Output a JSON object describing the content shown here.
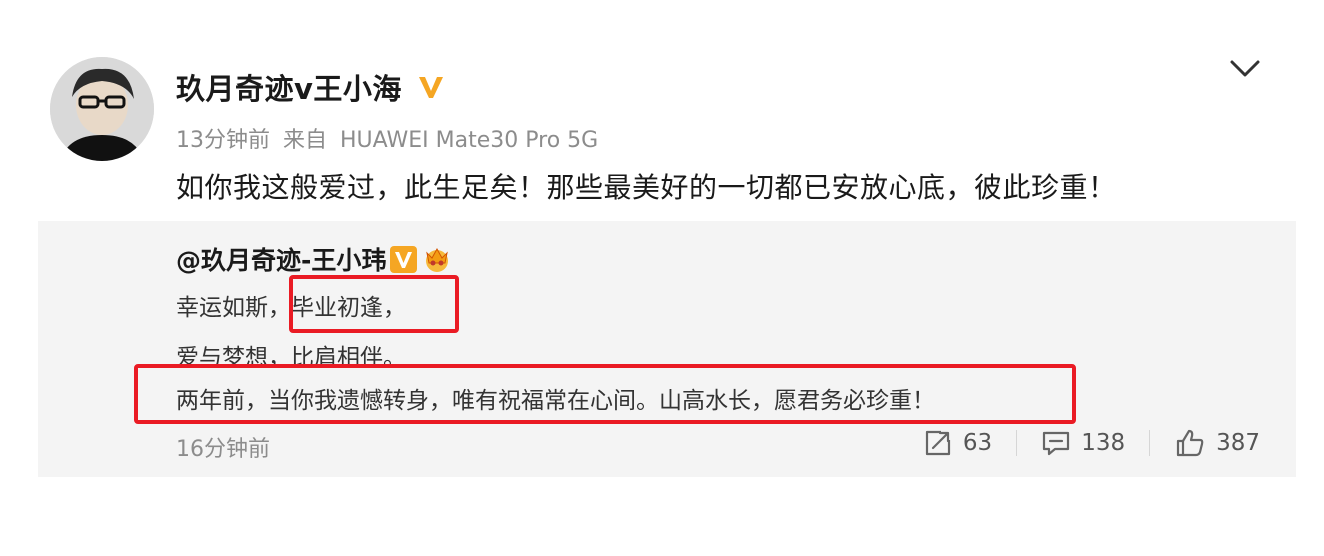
{
  "post": {
    "author": "玖月奇迹v王小海",
    "meta_time": "13分钟前",
    "meta_from": "来自",
    "meta_device": "HUAWEI Mate30 Pro 5G",
    "text": "如你我这般爱过，此生足矣！那些最美好的一切都已安放心底，彼此珍重！"
  },
  "repost": {
    "author": "@玖月奇迹-王小玮",
    "line1_prefix": "幸运如斯，",
    "line1_highlight": "毕业初逢，",
    "line2": "爱与梦想，比肩相伴。",
    "line3": "两年前，当你我遗憾转身，唯有祝福常在心间。山高水长，愿君务必珍重！",
    "time": "16分钟前",
    "repost_count": "63",
    "comment_count": "138",
    "like_count": "387"
  },
  "colors": {
    "highlight": "#ea1b24",
    "verified": "#f5a623",
    "muted": "#8c8c8c",
    "repost_bg": "#f4f4f4"
  },
  "icons": {
    "avatar": "avatar",
    "verified": "verified-v-icon",
    "menu": "chevron-down-icon",
    "repost": "repost-icon",
    "comment": "comment-icon",
    "like": "thumbs-up-icon",
    "crown": "crown-badge-icon"
  }
}
